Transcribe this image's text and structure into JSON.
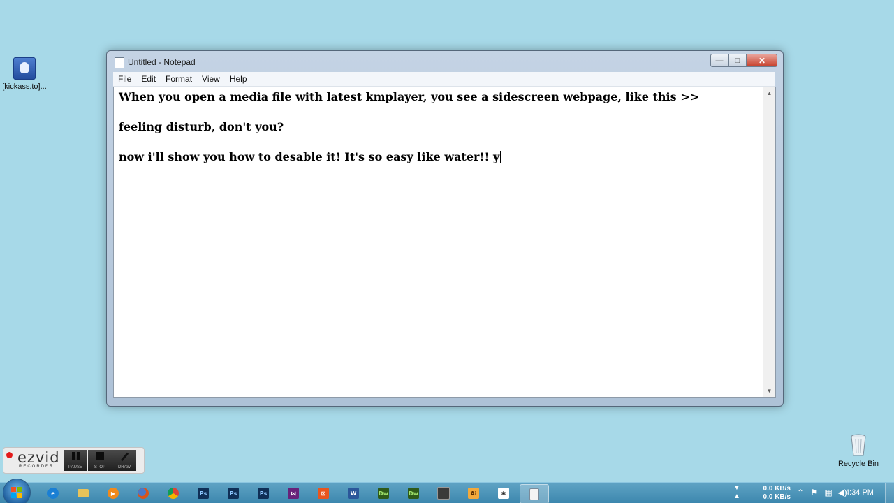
{
  "desktop": {
    "icons": [
      {
        "label": "[kickass.to]..."
      },
      {
        "label": "Recycle Bin"
      }
    ]
  },
  "notepad": {
    "title": "Untitled - Notepad",
    "menu": [
      "File",
      "Edit",
      "Format",
      "View",
      "Help"
    ],
    "lines": [
      "When you open a media file with latest kmplayer, you see a sidescreen webpage, like this >>",
      "feeling disturb, don't you?",
      "now i'll show you how to desable it! It's so easy like water!! y"
    ],
    "window_buttons": {
      "minimize": "—",
      "maximize": "□",
      "close": "✕"
    }
  },
  "ezvid": {
    "logo": "ezvid",
    "subtitle": "RECORDER",
    "buttons": [
      "PAUSE",
      "STOP",
      "DRAW"
    ]
  },
  "taskbar": {
    "apps": [
      {
        "name": "internet-explorer",
        "short": "e",
        "color": "#1a7fd4"
      },
      {
        "name": "windows-explorer",
        "short": "",
        "color": "#e8c35a"
      },
      {
        "name": "media-player",
        "short": "▶",
        "color": "#f08a1c"
      },
      {
        "name": "firefox",
        "short": "",
        "color": "#d9541c"
      },
      {
        "name": "chrome",
        "short": "",
        "color": "#3a9b3a"
      },
      {
        "name": "photoshop-1",
        "short": "Ps",
        "color": "#0f2f56"
      },
      {
        "name": "photoshop-2",
        "short": "Ps",
        "color": "#0f2f56"
      },
      {
        "name": "photoshop-3",
        "short": "Ps",
        "color": "#0f2f56"
      },
      {
        "name": "visual-studio",
        "short": "⋈",
        "color": "#68217a"
      },
      {
        "name": "xampp",
        "short": "⊠",
        "color": "#e8551e"
      },
      {
        "name": "word",
        "short": "W",
        "color": "#2b579a"
      },
      {
        "name": "dreamweaver-1",
        "short": "Dw",
        "color": "#2e5a19"
      },
      {
        "name": "dreamweaver-2",
        "short": "Dw",
        "color": "#2e5a19"
      },
      {
        "name": "app-dark",
        "short": "",
        "color": "#3a3a3a"
      },
      {
        "name": "illustrator",
        "short": "Ai",
        "color": "#e37a12"
      },
      {
        "name": "app-star",
        "short": "✱",
        "color": "#ffffff"
      },
      {
        "name": "notepad",
        "short": "",
        "color": "#f4f4f4"
      }
    ],
    "tray": {
      "download_speed": "0.0 KB/s",
      "upload_speed": "0.0 KB/s",
      "clock": "4:34 PM"
    }
  }
}
